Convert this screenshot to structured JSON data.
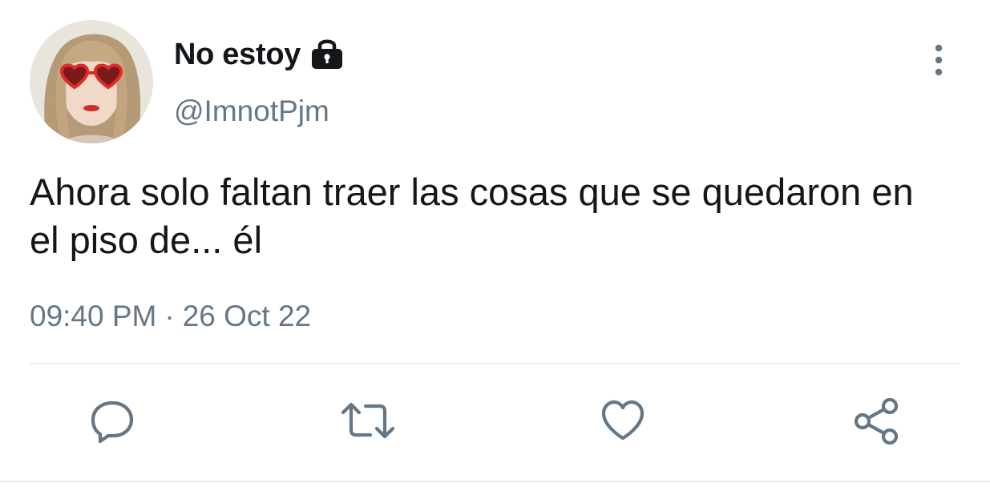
{
  "tweet": {
    "display_name": "No estoy",
    "handle": "@ImnotPjm",
    "text": "Ahora solo faltan traer las cosas que se quedaron en el piso de... él",
    "time": "09:40 PM",
    "separator": "·",
    "date": "26 Oct 22",
    "verified_lock": "lock-icon"
  },
  "actions": {
    "reply": "reply-icon",
    "retweet": "retweet-icon",
    "like": "heart-icon",
    "share": "share-icon"
  },
  "colors": {
    "text_primary": "#14171a",
    "text_secondary": "#657786",
    "icon": "#657786",
    "divider": "#e6ecf0"
  }
}
